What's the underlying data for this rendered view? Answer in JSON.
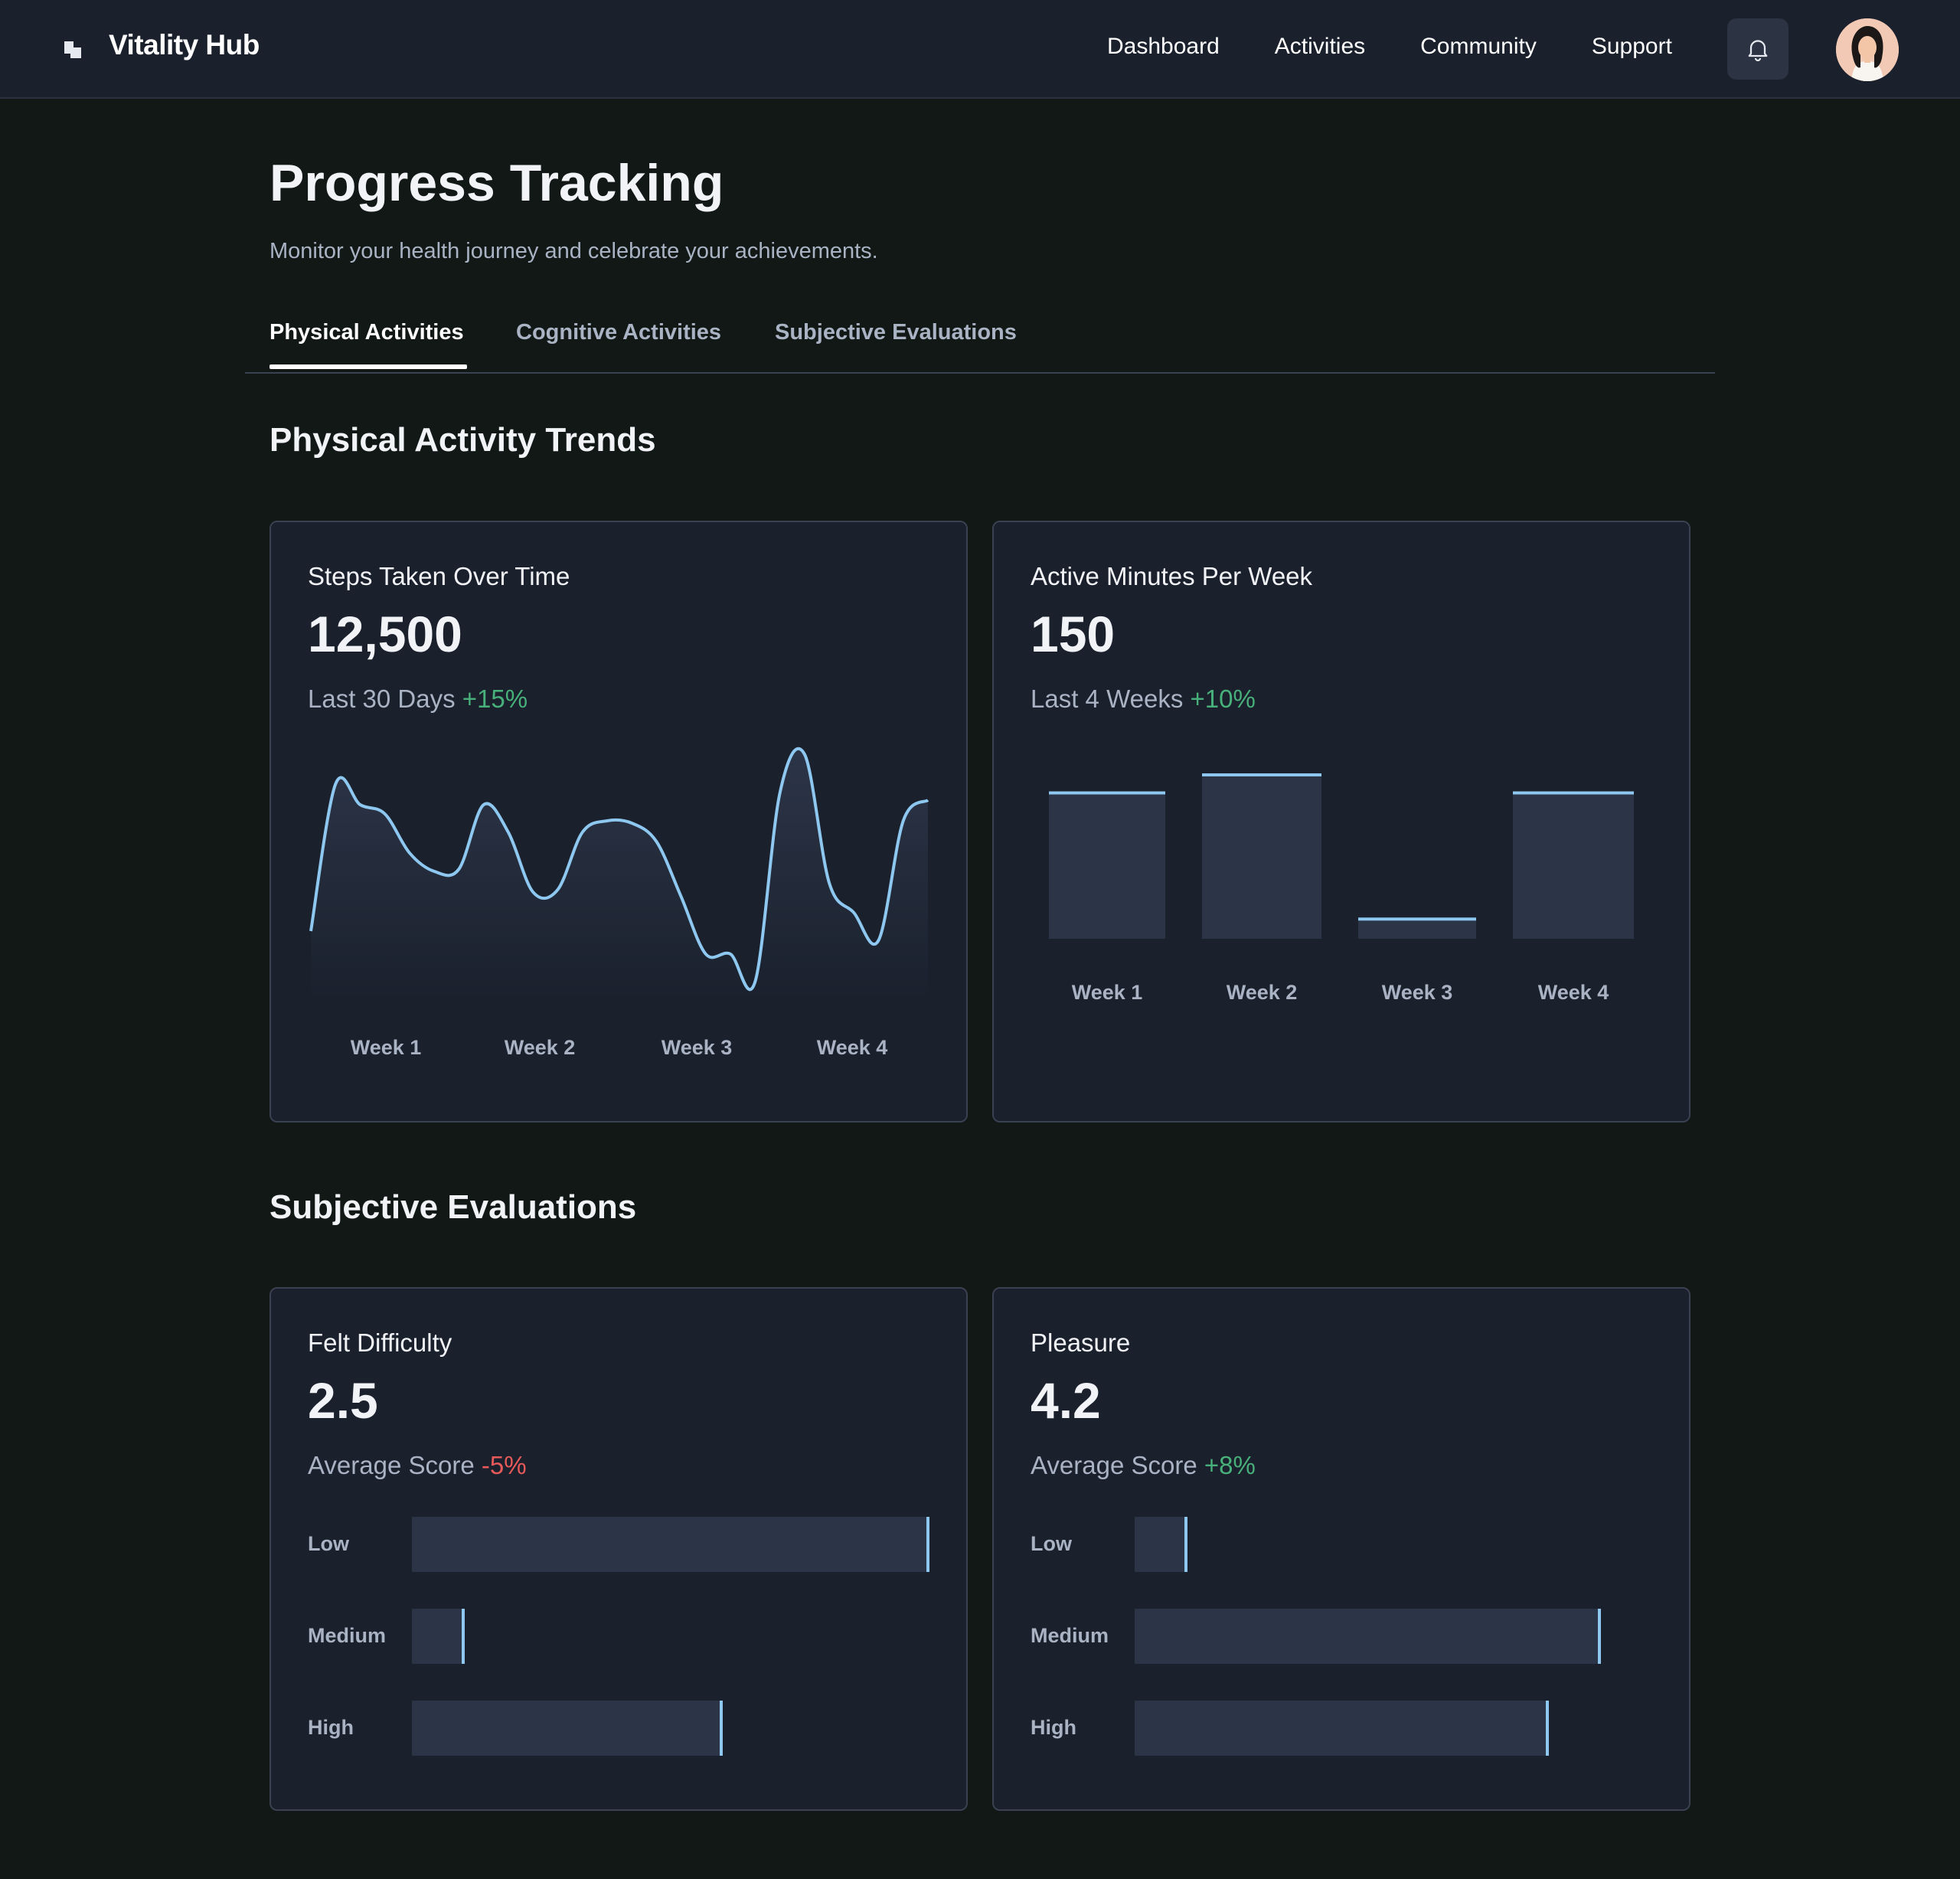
{
  "header": {
    "brand": "Vitality Hub",
    "nav": [
      "Dashboard",
      "Activities",
      "Community",
      "Support"
    ]
  },
  "page": {
    "title": "Progress Tracking",
    "subtitle": "Monitor your health journey and celebrate your achievements."
  },
  "tabs": [
    {
      "label": "Physical Activities",
      "active": true
    },
    {
      "label": "Cognitive Activities",
      "active": false
    },
    {
      "label": "Subjective Evaluations",
      "active": false
    }
  ],
  "sections": {
    "physical": "Physical Activity Trends",
    "subjective": "Subjective Evaluations"
  },
  "cards": {
    "steps": {
      "title": "Steps Taken Over Time",
      "value": "12,500",
      "period": "Last 30 Days",
      "change": "+15%"
    },
    "minutes": {
      "title": "Active Minutes Per Week",
      "value": "150",
      "period": "Last 4 Weeks",
      "change": "+10%"
    },
    "difficulty": {
      "title": "Felt Difficulty",
      "value": "2.5",
      "period": "Average Score",
      "change": "-5%"
    },
    "pleasure": {
      "title": "Pleasure",
      "value": "4.2",
      "period": "Average Score",
      "change": "+8%"
    }
  },
  "colors": {
    "accent_line": "#8ec8f0",
    "positive": "#48b07a",
    "negative": "#e85a5a"
  },
  "chart_data": [
    {
      "type": "area",
      "title": "Steps Taken Over Time",
      "categories": [
        "Week 1",
        "Week 2",
        "Week 3",
        "Week 4"
      ],
      "values": [
        0.22,
        0.86,
        0.77,
        0.73,
        0.56,
        0.48,
        0.49,
        0.77,
        0.65,
        0.39,
        0.4,
        0.65,
        0.7,
        0.69,
        0.61,
        0.37,
        0.12,
        0.12,
        0.0,
        0.82,
        0.99,
        0.43,
        0.3,
        0.18,
        0.7,
        0.79
      ]
    },
    {
      "type": "bar",
      "title": "Active Minutes Per Week",
      "categories": [
        "Week 1",
        "Week 2",
        "Week 3",
        "Week 4"
      ],
      "values": [
        0.89,
        1.0,
        0.12,
        0.89
      ]
    },
    {
      "type": "bar",
      "title": "Felt Difficulty",
      "categories": [
        "Low",
        "Medium",
        "High"
      ],
      "values": [
        1.0,
        0.1,
        0.6
      ]
    },
    {
      "type": "bar",
      "title": "Pleasure",
      "categories": [
        "Low",
        "Medium",
        "High"
      ],
      "values": [
        0.1,
        0.9,
        0.8
      ]
    }
  ]
}
